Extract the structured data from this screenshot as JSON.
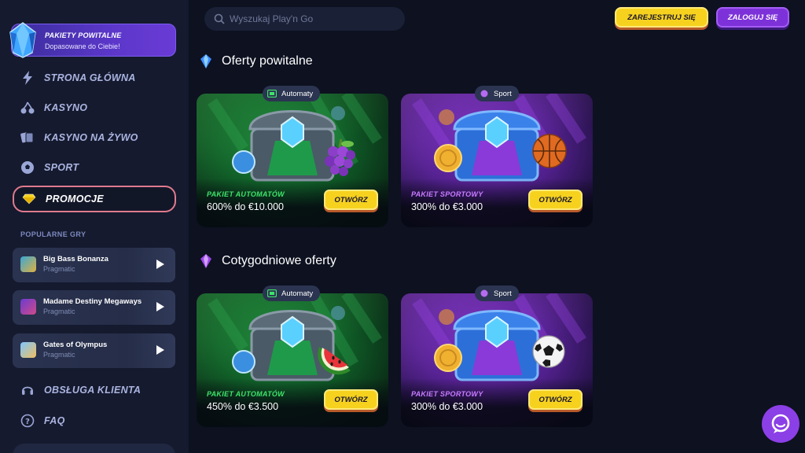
{
  "welcome": {
    "title": "PAKIETY POWITALNE",
    "subtitle": "Dopasowane do Ciebie!"
  },
  "nav": {
    "items": [
      {
        "label": "STRONA GŁÓWNA",
        "icon": "lightning-icon"
      },
      {
        "label": "KASYNO",
        "icon": "cherries-icon"
      },
      {
        "label": "KASYNO NA ŻYWO",
        "icon": "cards-icon"
      },
      {
        "label": "SPORT",
        "icon": "soccer-ball-icon"
      },
      {
        "label": "PROMOCJE",
        "icon": "diamond-icon",
        "active": true
      }
    ],
    "support_items": [
      {
        "label": "OBSŁUGA KLIENTA",
        "icon": "headset-icon"
      },
      {
        "label": "FAQ",
        "icon": "question-icon"
      }
    ]
  },
  "popular": {
    "label": "POPULARNE GRY",
    "games": [
      {
        "name": "Big Bass Bonanza",
        "provider": "Pragmatic"
      },
      {
        "name": "Madame Destiny Megaways",
        "provider": "Pragmatic"
      },
      {
        "name": "Gates of Olympus",
        "provider": "Pragmatic"
      }
    ]
  },
  "header": {
    "search_placeholder": "Wyszukaj Play'n Go",
    "register_label": "ZAREJESTRUJ SIĘ",
    "login_label": "ZALOGUJ SIĘ"
  },
  "sections": [
    {
      "title": "Oferty powitalne",
      "cards": [
        {
          "tag": "Automaty",
          "title": "PAKIET AUTOMATÓW",
          "amount": "600% do €10.000",
          "button": "OTWÓRZ",
          "theme": "green",
          "item": "grapes"
        },
        {
          "tag": "Sport",
          "title": "PAKIET SPORTOWY",
          "amount": "300% do €3.000",
          "button": "OTWÓRZ",
          "theme": "purple",
          "item": "basketball"
        }
      ]
    },
    {
      "title": "Cotygodniowe oferty",
      "cards": [
        {
          "tag": "Automaty",
          "title": "PAKIET AUTOMATÓW",
          "amount": "450% do €3.500",
          "button": "OTWÓRZ",
          "theme": "green",
          "item": "watermelon"
        },
        {
          "tag": "Sport",
          "title": "PAKIET SPORTOWY",
          "amount": "300% do €3.000",
          "button": "OTWÓRZ",
          "theme": "purple",
          "item": "soccer-ball"
        }
      ]
    }
  ],
  "colors": {
    "accent_yellow": "#f6d21f",
    "accent_purple": "#7d32d9",
    "slots_green": "#3fe36b",
    "sport_purple": "#c77bff",
    "background": "#0d1120",
    "sidebar": "#151a2e"
  }
}
